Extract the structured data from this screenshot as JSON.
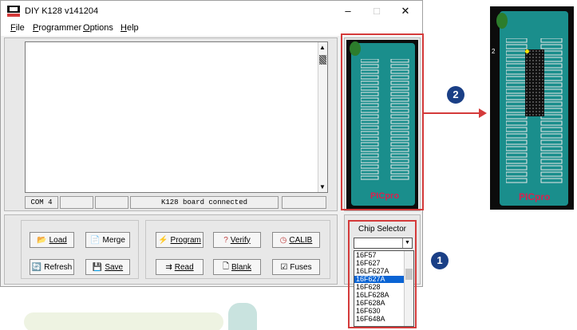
{
  "window": {
    "title": "DIY K128 v141204",
    "minimize_glyph": "–",
    "maximize_glyph": "□",
    "close_glyph": "✕"
  },
  "menu": {
    "items": [
      {
        "hot": "F",
        "rest": "ile"
      },
      {
        "hot": "P",
        "rest": "rogrammer"
      },
      {
        "hot": "O",
        "rest": "ptions"
      },
      {
        "hot": "H",
        "rest": "elp"
      }
    ]
  },
  "status": {
    "port": "COM 4",
    "message": "K128 board connected"
  },
  "buttons": {
    "load": "Load",
    "refresh": "Refresh",
    "merge": "Merge",
    "save": "Save",
    "program": "Program",
    "read": "Read",
    "verify": "Verify",
    "blank": "Blank",
    "calib": "CALIB",
    "fuses": "Fuses"
  },
  "chip_selector": {
    "label": "Chip Selector",
    "selected_value": "",
    "options": [
      "16F57",
      "16F627",
      "16LF627A",
      "16F627A",
      "16F628",
      "16LF628A",
      "16F628A",
      "16F630",
      "16F648A"
    ],
    "selected_index": 3
  },
  "board": {
    "brand": "PICpro",
    "pin_number": "2"
  },
  "badges": {
    "one": "1",
    "two": "2"
  },
  "colors": {
    "board": "#1a8e8c",
    "highlight": "#d43a3a",
    "badge": "#1a3f86",
    "selection": "#0a64d4"
  }
}
